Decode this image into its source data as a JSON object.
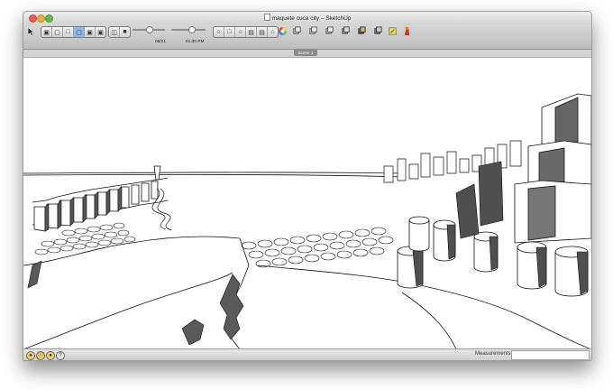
{
  "window": {
    "title": "maquete cuca city – SketchUp"
  },
  "toolbar": {
    "tools": [
      "select-tool-icon",
      "iso-view-icon",
      "top-view-icon",
      "front-view-icon",
      "right-view-icon",
      "back-view-icon",
      "left-view-icon",
      "xray-icon",
      "wireframe-icon",
      "shaded-icon",
      "textured-icon"
    ],
    "shadow_date": "06/21",
    "shadow_time": "01:30 PM",
    "date_slider_fraction": 0.45,
    "time_slider_fraction": 0.55
  },
  "scene": {
    "tab_label": "Scene 1"
  },
  "statusbar": {
    "measurements_label": "Measurements",
    "measurements_value": ""
  }
}
